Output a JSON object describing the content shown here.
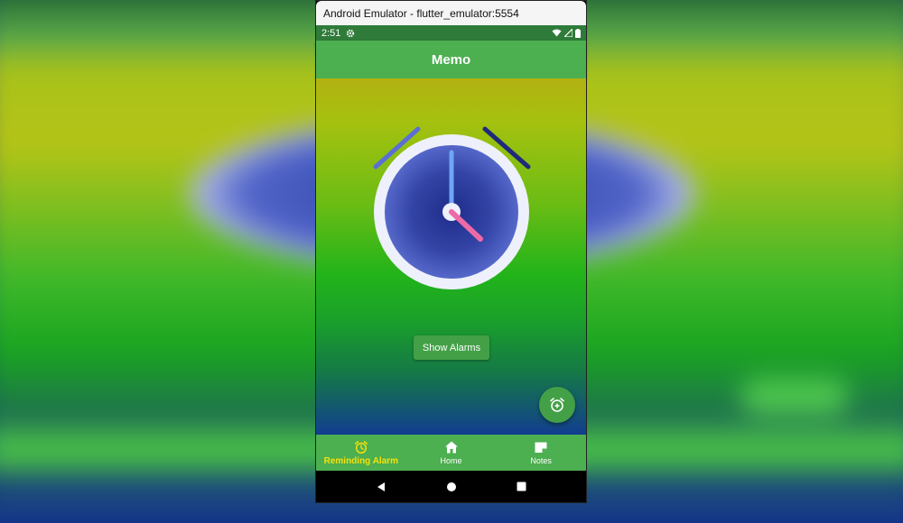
{
  "window": {
    "title": "Android Emulator - flutter_emulator:5554"
  },
  "status_bar": {
    "time": "2:51",
    "icons": [
      "gear-icon",
      "wifi-icon",
      "signal-icon",
      "battery-icon"
    ]
  },
  "app_bar": {
    "title": "Memo"
  },
  "main": {
    "show_alarms_label": "Show Alarms",
    "fab_icon": "add-alarm-icon"
  },
  "bottom_nav": {
    "items": [
      {
        "label": "Reminding Alarm",
        "icon": "alarm-icon",
        "active": true
      },
      {
        "label": "Home",
        "icon": "home-icon",
        "active": false
      },
      {
        "label": "Notes",
        "icon": "note-icon",
        "active": false
      }
    ]
  },
  "system_nav": [
    "back-icon",
    "home-circle-icon",
    "recents-icon"
  ],
  "colors": {
    "primary": "#4caf50",
    "status_bar": "#2f7b3a",
    "active_nav": "#f5e10a",
    "clock_face": "#3f51b5",
    "hour_hand": "#f06292",
    "minute_hand": "#64a0f0"
  }
}
